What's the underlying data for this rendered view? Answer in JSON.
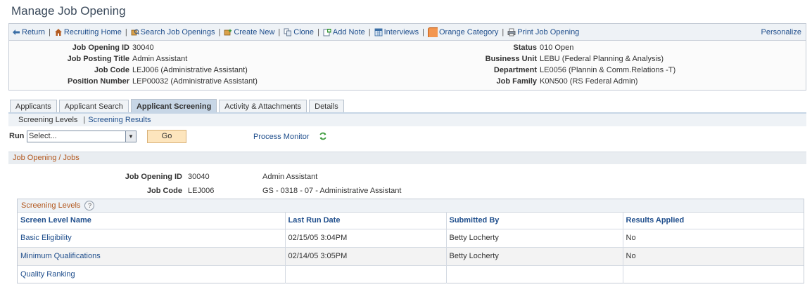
{
  "page": {
    "title": "Manage Job Opening"
  },
  "toolbar": {
    "items": [
      {
        "label": "Return",
        "icon": "return-arrow-icon"
      },
      {
        "label": "Recruiting Home",
        "icon": "home-icon"
      },
      {
        "label": "Search Job Openings",
        "icon": "search-job-icon"
      },
      {
        "label": "Create New",
        "icon": "create-new-icon"
      },
      {
        "label": "Clone",
        "icon": "clone-icon"
      },
      {
        "label": "Add Note",
        "icon": "add-note-icon"
      },
      {
        "label": "Interviews",
        "icon": "interviews-icon"
      },
      {
        "label": "Orange Category",
        "icon": "category-icon"
      },
      {
        "label": "Print Job Opening",
        "icon": "print-icon"
      }
    ],
    "personalize": "Personalize"
  },
  "header": {
    "left": [
      {
        "label": "Job Opening ID",
        "value": "30040"
      },
      {
        "label": "Job Posting Title",
        "value": "Admin Assistant"
      },
      {
        "label": "Job Code",
        "value": "LEJ006 (Administrative Assistant)"
      },
      {
        "label": "Position Number",
        "value": "LEP00032 (Administrative Assistant)"
      }
    ],
    "right": [
      {
        "label": "Status",
        "value": "010 Open"
      },
      {
        "label": "Business Unit",
        "value": "LEBU (Federal Planning & Analysis)"
      },
      {
        "label": "Department",
        "value": "LE0056 (Plannin & Comm.Relations -T)"
      },
      {
        "label": "Job Family",
        "value": "K0N500 (RS Federal Admin)"
      }
    ]
  },
  "tabs": [
    "Applicants",
    "Applicant Search",
    "Applicant Screening",
    "Activity & Attachments",
    "Details"
  ],
  "active_tab": "Applicant Screening",
  "subnav": {
    "current": "Screening Levels",
    "link": "Screening Results"
  },
  "run": {
    "label": "Run",
    "selected": "Select...",
    "go": "Go",
    "process_monitor": "Process Monitor"
  },
  "jobs_section": {
    "title": "Job Opening / Jobs",
    "job_opening_id_label": "Job Opening ID",
    "job_opening_id": "30040",
    "job_opening_title": "Admin Assistant",
    "job_code_label": "Job Code",
    "job_code": "LEJ006",
    "job_code_desc": "GS - 0318 - 07 - Administrative Assistant"
  },
  "screening": {
    "title": "Screening Levels",
    "help_icon": "help-icon",
    "columns": [
      "Screen Level Name",
      "Last Run Date",
      "Submitted By",
      "Results Applied"
    ],
    "rows": [
      {
        "name": "Basic Eligibility",
        "date": "02/15/05 3:04PM",
        "by": "Betty Locherty",
        "applied": "No"
      },
      {
        "name": "Minimum Qualifications",
        "date": "02/14/05 3:05PM",
        "by": "Betty Locherty",
        "applied": "No"
      },
      {
        "name": "Quality Ranking",
        "date": "",
        "by": "",
        "applied": ""
      }
    ]
  }
}
